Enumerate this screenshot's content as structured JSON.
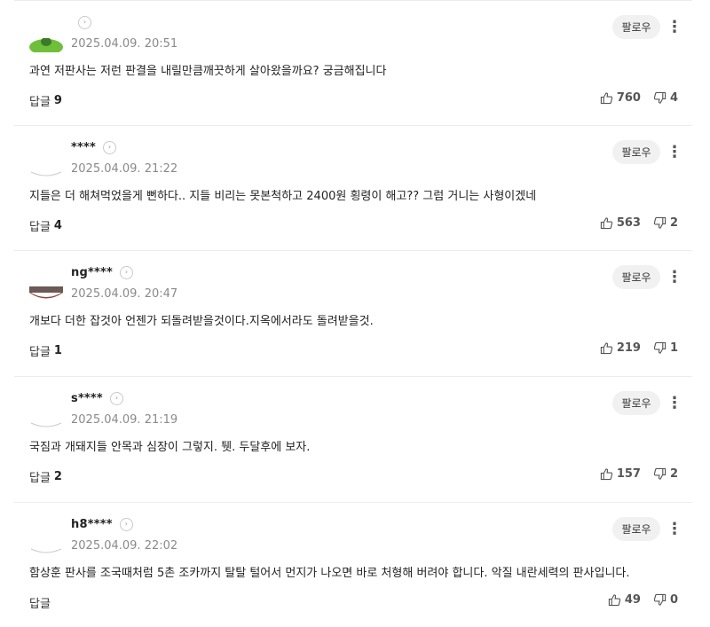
{
  "follow_label": "팔로우",
  "reply_label": "답글",
  "comments": [
    {
      "author": "",
      "timestamp": "2025.04.09. 20:51",
      "text": "과연 저판사는 저런 판결을 내릴만큼깨끗하게 살아왔을까요? 궁금해집니다",
      "replies": "9",
      "likes": "760",
      "dislikes": "4",
      "avatar_color": "#6fbf3a"
    },
    {
      "author": "****",
      "timestamp": "2025.04.09. 21:22",
      "text": "지들은 더 해쳐먹었을게 뻔하다.. 지들 비리는 못본척하고 2400원 횡령이 해고?? 그럼 거니는 사형이겠네",
      "replies": "4",
      "likes": "563",
      "dislikes": "2",
      "avatar_color": "#cccccc"
    },
    {
      "author": "ng****",
      "timestamp": "2025.04.09. 20:47",
      "text": "개보다 더한 잡것아 언젠가 되돌려받을것이다.지옥에서라도 돌려받을것.",
      "replies": "1",
      "likes": "219",
      "dislikes": "1",
      "avatar_color": "#8a4a3c"
    },
    {
      "author": "s****",
      "timestamp": "2025.04.09. 21:19",
      "text": "국짐과 개돼지들 안목과 심장이 그렇지. 퉷. 두달후에 보자.",
      "replies": "2",
      "likes": "157",
      "dislikes": "2",
      "avatar_color": "#cccccc"
    },
    {
      "author": "h8****",
      "timestamp": "2025.04.09. 22:02",
      "text": "함상훈 판사를 조국때처럼 5촌 조카까지 탈탈 털어서 먼지가 나오면 바로 처형해 버려야 합니다. 악질 내란세력의 판사입니다.",
      "replies": "",
      "likes": "49",
      "dislikes": "0",
      "avatar_color": "#cccccc"
    }
  ]
}
